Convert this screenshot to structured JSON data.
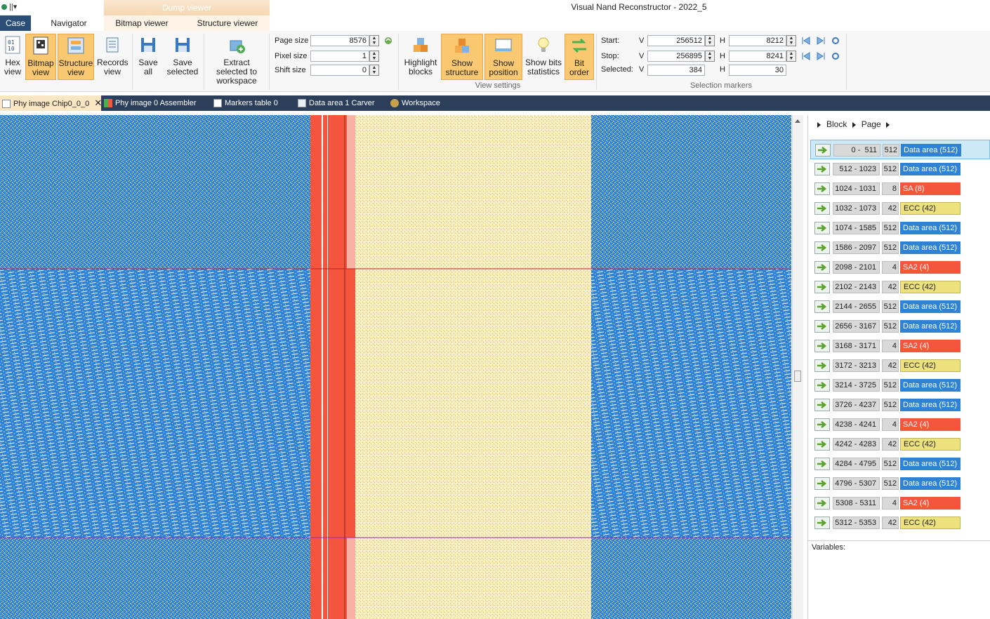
{
  "titlebar": {
    "app_title": "Visual Nand Reconstructor - 2022_5",
    "context_group": "Dump viewer",
    "quick_access": "||▾"
  },
  "ribbon_tabs": {
    "case": "Case",
    "navigator": "Navigator",
    "bitmap_viewer": "Bitmap viewer",
    "structure_viewer": "Structure viewer"
  },
  "ribbon": {
    "hex_view": "Hex view",
    "bitmap_view": "Bitmap view",
    "structure_view": "Structure view",
    "records_view": "Records view",
    "save_all": "Save all",
    "save_selected": "Save selected",
    "extract_selected": "Extract selected to workspace",
    "page_size_label": "Page size",
    "page_size_value": "8576",
    "pixel_size_label": "Pixel size",
    "pixel_size_value": "1",
    "shift_size_label": "Shift size",
    "shift_size_value": "0",
    "highlight_blocks": "Highlight blocks",
    "show_structure": "Show structure",
    "show_position": "Show position",
    "show_bits_statistics": "Show bits statistics",
    "bit_order": "Bit order",
    "view_settings_group": "View settings",
    "start_label": "Start:",
    "stop_label": "Stop:",
    "selected_label": "Selected:",
    "v_label": "V",
    "h_label": "H",
    "start_v": "256512",
    "start_h": "8212",
    "stop_v": "256895",
    "stop_h": "8241",
    "selected_v": "384",
    "selected_h": "30",
    "selection_markers_group": "Selection markers"
  },
  "doc_tabs": [
    {
      "label": "Phy image Chip0_0_0"
    },
    {
      "label": "Phy image 0 Assembler"
    },
    {
      "label": "Markers table 0"
    },
    {
      "label": "Data area 1 Carver"
    },
    {
      "label": "Workspace"
    }
  ],
  "breadcrumb": {
    "block": "Block",
    "page": "Page"
  },
  "structure_rows": [
    {
      "range": "0 -  511",
      "size": "512",
      "type": "Data area (512)",
      "kind": "data"
    },
    {
      "range": "512 - 1023",
      "size": "512",
      "type": "Data area (512)",
      "kind": "data"
    },
    {
      "range": "1024 - 1031",
      "size": "8",
      "type": "SA (8)",
      "kind": "sa"
    },
    {
      "range": "1032 - 1073",
      "size": "42",
      "type": "ECC (42)",
      "kind": "ecc"
    },
    {
      "range": "1074 - 1585",
      "size": "512",
      "type": "Data area (512)",
      "kind": "data"
    },
    {
      "range": "1586 - 2097",
      "size": "512",
      "type": "Data area (512)",
      "kind": "data"
    },
    {
      "range": "2098 - 2101",
      "size": "4",
      "type": "SA2 (4)",
      "kind": "sa"
    },
    {
      "range": "2102 - 2143",
      "size": "42",
      "type": "ECC (42)",
      "kind": "ecc"
    },
    {
      "range": "2144 - 2655",
      "size": "512",
      "type": "Data area (512)",
      "kind": "data"
    },
    {
      "range": "2656 - 3167",
      "size": "512",
      "type": "Data area (512)",
      "kind": "data"
    },
    {
      "range": "3168 - 3171",
      "size": "4",
      "type": "SA2 (4)",
      "kind": "sa"
    },
    {
      "range": "3172 - 3213",
      "size": "42",
      "type": "ECC (42)",
      "kind": "ecc"
    },
    {
      "range": "3214 - 3725",
      "size": "512",
      "type": "Data area (512)",
      "kind": "data"
    },
    {
      "range": "3726 - 4237",
      "size": "512",
      "type": "Data area (512)",
      "kind": "data"
    },
    {
      "range": "4238 - 4241",
      "size": "4",
      "type": "SA2 (4)",
      "kind": "sa"
    },
    {
      "range": "4242 - 4283",
      "size": "42",
      "type": "ECC (42)",
      "kind": "ecc"
    },
    {
      "range": "4284 - 4795",
      "size": "512",
      "type": "Data area (512)",
      "kind": "data"
    },
    {
      "range": "4796 - 5307",
      "size": "512",
      "type": "Data area (512)",
      "kind": "data"
    },
    {
      "range": "5308 - 5311",
      "size": "4",
      "type": "SA2 (4)",
      "kind": "sa"
    },
    {
      "range": "5312 - 5353",
      "size": "42",
      "type": "ECC (42)",
      "kind": "ecc"
    }
  ],
  "variables_label": "Variables:",
  "colors": {
    "data": "#2f82d4",
    "sa": "#f4553d",
    "ecc": "#ede17d",
    "case_tab": "#2a4e76",
    "doc_tabs_bg": "#2b3f5a",
    "active_button": "#f9c870"
  }
}
